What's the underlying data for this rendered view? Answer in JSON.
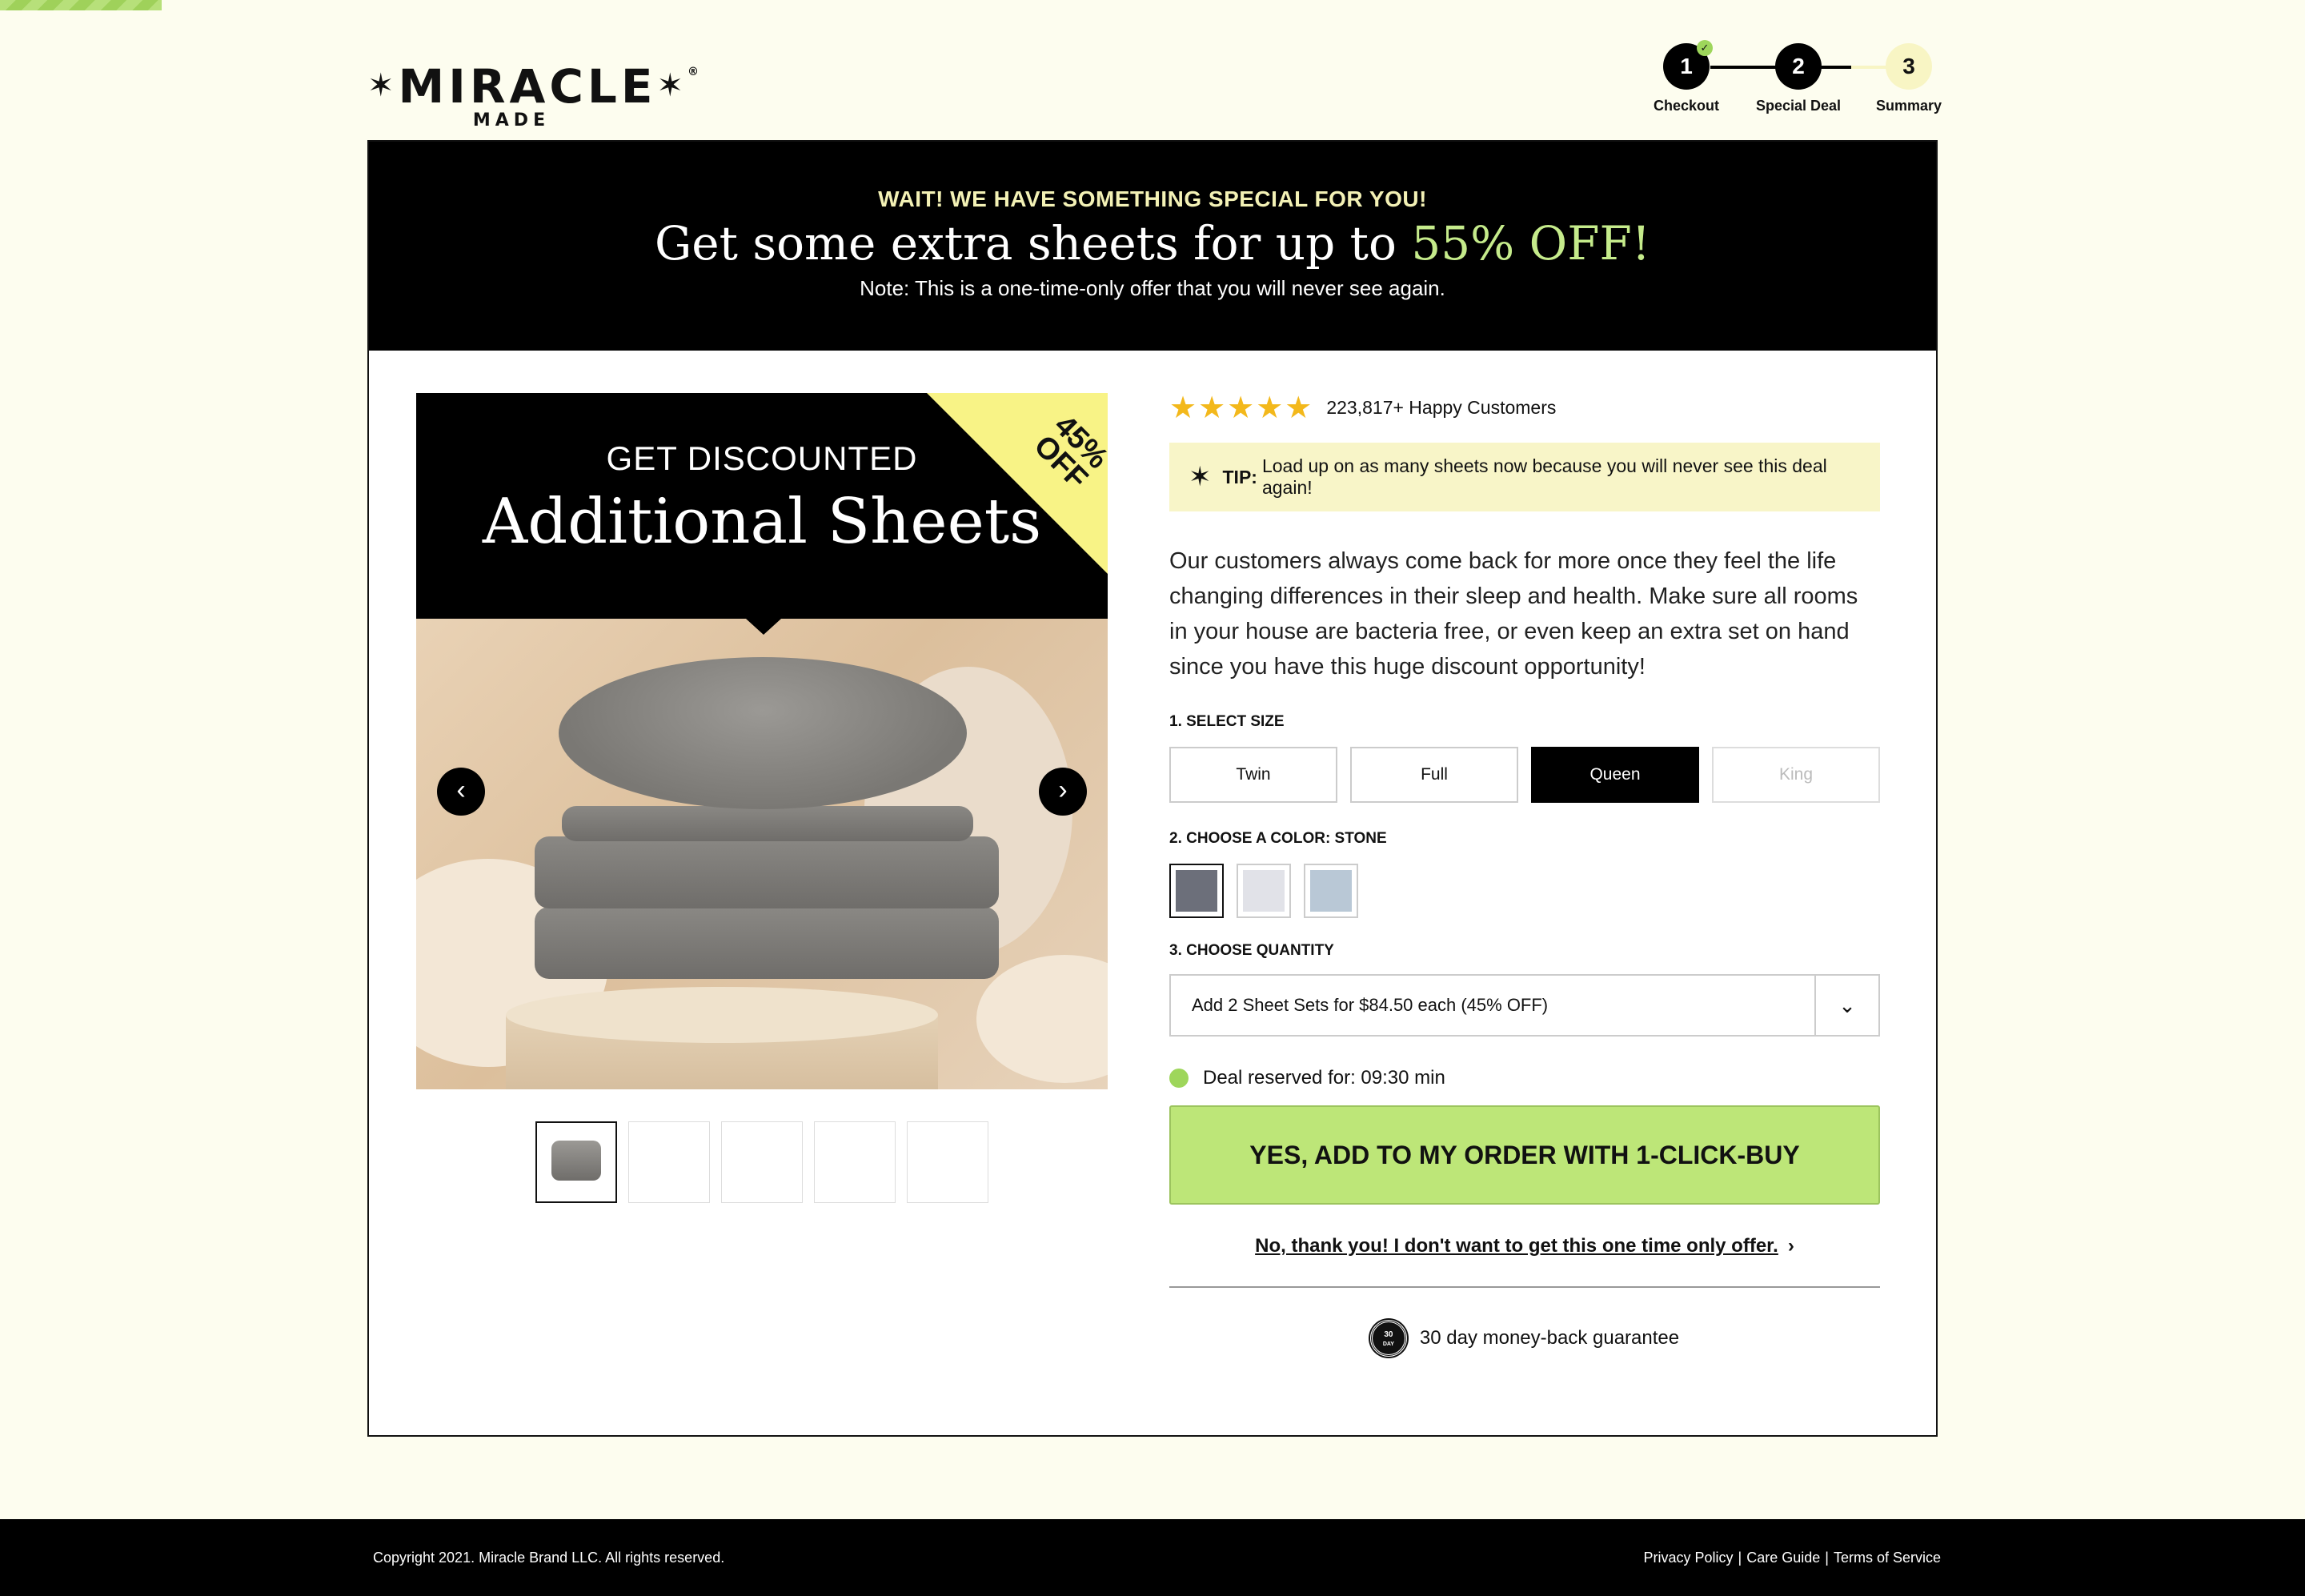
{
  "brand": {
    "name": "MIRACLE",
    "sub": "MADE",
    "star": "✶",
    "registered": "®"
  },
  "steps": [
    {
      "number": "1",
      "label": "Checkout",
      "status": "complete"
    },
    {
      "number": "2",
      "label": "Special Deal",
      "status": "current"
    },
    {
      "number": "3",
      "label": "Summary",
      "status": "pending"
    }
  ],
  "banner": {
    "kicker": "WAIT! WE HAVE SOMETHING SPECIAL FOR YOU!",
    "headline_prefix": "Get some extra sheets for up to ",
    "headline_accent": "55% OFF!",
    "note": "Note: This is a one-time-only offer that you will never see again."
  },
  "promo": {
    "kicker": "GET DISCOUNTED",
    "title": "Additional Sheets",
    "corner_line1": "45%",
    "corner_line2": "OFF"
  },
  "gallery": {
    "prev_icon": "‹",
    "next_icon": "›"
  },
  "rating": {
    "stars": "★★★★★",
    "text": "223,817+ Happy Customers"
  },
  "tip": {
    "icon": "✶",
    "label": "TIP:",
    "text": "Load up on as many sheets now because you will never see this deal again!"
  },
  "description": "Our customers always come back for more once they feel the life changing differences in their sleep and health. Make sure all rooms in your house are bacteria free, or even keep an extra set on hand since you have this huge discount opportunity!",
  "size": {
    "label": "1. SELECT SIZE",
    "options": [
      "Twin",
      "Full",
      "Queen",
      "King"
    ],
    "selected": "Queen"
  },
  "color": {
    "label": "2. CHOOSE A COLOR: STONE",
    "swatches": [
      "#6c6f7a",
      "#e1e2e8",
      "#b9c8d6"
    ]
  },
  "quantity": {
    "label": "3. CHOOSE QUANTITY",
    "value": "Add 2 Sheet Sets for $84.50 each (45% OFF)",
    "chevron": "⌄"
  },
  "timer": {
    "text": "Deal reserved for: 09:30 min"
  },
  "cta": {
    "label": "YES, ADD TO MY ORDER WITH 1-CLICK-BUY"
  },
  "decline": {
    "label": "No, thank you! I don't want to get this one time only offer.",
    "chevron": "›"
  },
  "guarantee": {
    "seal_top": "30",
    "seal_bottom": "DAY",
    "text": "30 day money-back guarantee"
  },
  "footer": {
    "copyright": "Copyright 2021. Miracle Brand LLC. All rights reserved.",
    "links": [
      "Privacy Policy",
      "Care Guide",
      "Terms of Service"
    ],
    "separator": "|"
  }
}
